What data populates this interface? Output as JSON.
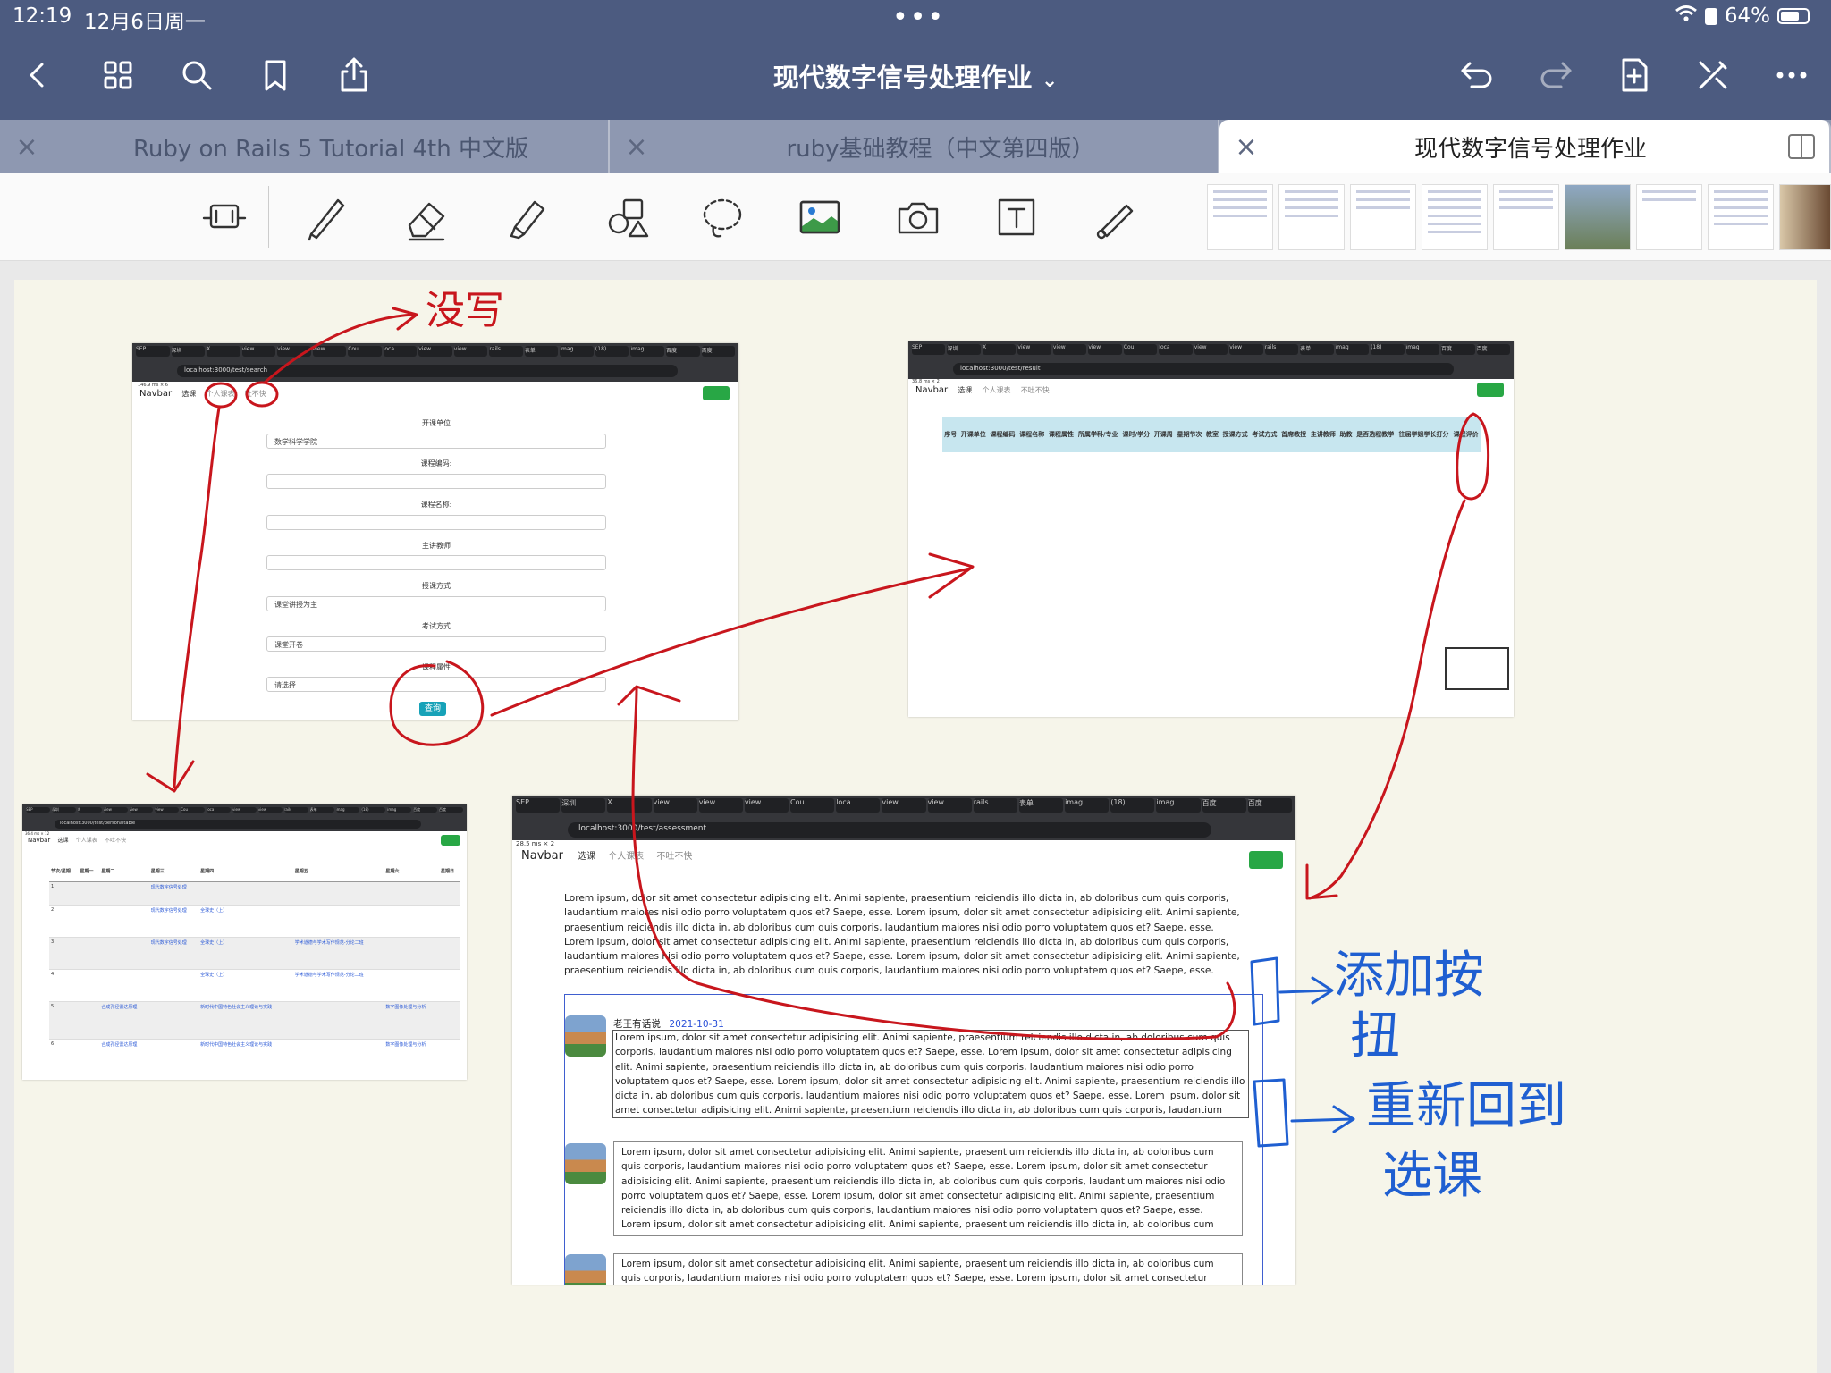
{
  "status": {
    "time": "12:19",
    "date": "12月6日周一",
    "battery": "64%"
  },
  "toolbar": {
    "title": "现代数字信号处理作业",
    "title_caret": "⌄"
  },
  "tabs": [
    {
      "label": "Ruby on Rails 5 Tutorial 4th 中文版"
    },
    {
      "label": "ruby基础教程（中文第四版）"
    },
    {
      "label": "现代数字信号处理作业"
    }
  ],
  "screens": {
    "search": {
      "url": "localhost:3000/test/search",
      "perf": "146.9 ms × 6",
      "nav": [
        "Navbar",
        "选课",
        "个人课表",
        "吐不快"
      ],
      "fields": [
        {
          "label": "开课单位",
          "value": "数学科学学院"
        },
        {
          "label": "课程编码:",
          "value": ""
        },
        {
          "label": "课程名称:",
          "value": ""
        },
        {
          "label": "主讲教师",
          "value": ""
        },
        {
          "label": "授课方式",
          "value": "课堂讲授为主"
        },
        {
          "label": "考试方式",
          "value": "课堂开卷"
        },
        {
          "label": "课程属性",
          "value": "请选择"
        }
      ],
      "button": "查询"
    },
    "result": {
      "url": "localhost:3000/test/result",
      "perf": "36.8 ms × 2",
      "nav": [
        "Navbar",
        "选课",
        "个人课表",
        "不吐不快"
      ],
      "headers": [
        "序号",
        "开课单位",
        "课程编码",
        "课程名称",
        "课程属性",
        "所属学科/专业",
        "课时/学分",
        "开课周",
        "星期节次",
        "教室",
        "授课方式",
        "考试方式",
        "首席教授",
        "主讲教师",
        "助教",
        "是否选程教学",
        "往届学姐学长打分",
        "课程评价"
      ]
    },
    "timetable": {
      "url": "localhost:3000/test/personaltable",
      "perf": "36.4 ms × 12",
      "nav": [
        "Navbar",
        "选课",
        "个人课表",
        "不吐不快"
      ],
      "headers": [
        "节次/星期",
        "星期一",
        "星期二",
        "星期三",
        "星期四",
        "星期五",
        "星期六",
        "星期日"
      ],
      "rows": [
        [
          "1",
          "",
          "",
          "现代数字信号处理",
          "",
          "",
          "",
          ""
        ],
        [
          "2",
          "",
          "",
          "现代数字信号处理",
          "全球史（上）",
          "",
          "",
          ""
        ],
        [
          "3",
          "",
          "",
          "现代数字信号处理",
          "全球史（上）",
          "学术道德与学术写作规范-分论二班",
          "",
          ""
        ],
        [
          "4",
          "",
          "",
          "",
          "全球史（上）",
          "学术道德与学术写作规范-分论二班",
          "",
          ""
        ],
        [
          "5",
          "",
          "合成孔径雷达原理",
          "",
          "新时代中国特色社会主义理论与实践",
          "",
          "数字图像处理与分析",
          ""
        ],
        [
          "6",
          "",
          "合成孔径雷达原理",
          "",
          "新时代中国特色社会主义理论与实践",
          "",
          "数字图像处理与分析",
          ""
        ]
      ]
    },
    "assessment": {
      "url": "localhost:3000/test/assessment",
      "perf": "28.5 ms × 2",
      "nav": [
        "Navbar",
        "选课",
        "个人课表",
        "不吐不快"
      ],
      "intro": "Lorem ipsum, dolor sit amet consectetur adipisicing elit. Animi sapiente, praesentium reiciendis illo dicta in, ab doloribus cum quis corporis, laudantium maiores nisi odio porro voluptatem quos et? Saepe, esse. Lorem ipsum, dolor sit amet consectetur adipisicing elit. Animi sapiente, praesentium reiciendis illo dicta in, ab doloribus cum quis corporis, laudantium maiores nisi odio porro voluptatem quos et? Saepe, esse. Lorem ipsum, dolor sit amet consectetur adipisicing elit. Animi sapiente, praesentium reiciendis illo dicta in, ab doloribus cum quis corporis, laudantium maiores nisi odio porro voluptatem quos et? Saepe, esse. Lorem ipsum, dolor sit amet consectetur adipisicing elit. Animi sapiente, praesentium reiciendis illo dicta in, ab doloribus cum quis corporis, laudantium maiores nisi odio porro voluptatem quos et? Saepe, esse. Lorem ipsum, dolor sit amet consectetur adipisicing elit. Animi sapiente, praesentium reiciendis illo dicta in, ab doloribus cum quis corporis, laudantium maiores nisi odio porro voluptatem quos et? Saepe, esse.",
      "post_author": "老王有话说",
      "post_date": "2021-10-31",
      "post_body": "Lorem ipsum, dolor sit amet consectetur adipisicing elit. Animi sapiente, praesentium reiciendis illo dicta in, ab doloribus cum quis corporis, laudantium maiores nisi odio porro voluptatem quos et? Saepe, esse. Lorem ipsum, dolor sit amet consectetur adipisicing elit. Animi sapiente, praesentium reiciendis illo dicta in, ab doloribus cum quis corporis, laudantium maiores nisi odio porro voluptatem quos et? Saepe, esse. Lorem ipsum, dolor sit amet consectetur adipisicing elit. Animi sapiente, praesentium reiciendis illo dicta in, ab doloribus cum quis corporis, laudantium maiores nisi odio porro voluptatem quos et? Saepe, esse. Lorem ipsum, dolor sit amet consectetur adipisicing elit. Animi sapiente, praesentium reiciendis illo dicta in, ab doloribus cum quis corporis, laudantium maiores nisi odio porro voluptatem quos et? Saepe, esse. Lorem ipsum, dolor sit",
      "comment_body": "Lorem ipsum, dolor sit amet consectetur adipisicing elit. Animi sapiente, praesentium reiciendis illo dicta in, ab doloribus cum quis corporis, laudantium maiores nisi odio porro voluptatem quos et? Saepe, esse. Lorem ipsum, dolor sit amet consectetur adipisicing elit. Animi sapiente, praesentium reiciendis illo dicta in, ab doloribus cum quis corporis, laudantium maiores nisi odio porro voluptatem quos et? Saepe, esse. Lorem ipsum, dolor sit amet consectetur adipisicing elit. Animi sapiente, praesentium reiciendis illo dicta in, ab doloribus cum quis corporis, laudantium maiores nisi odio porro voluptatem quos et? Saepe, esse. Lorem ipsum, dolor sit amet consectetur adipisicing elit. Animi sapiente, praesentium reiciendis illo dicta in, ab doloribus cum quis corporis, laudantium maiores nisi odio porro voluptatem quos et? Saepe, esse. Lorem ipsum, dolor",
      "comment_body_2": "Lorem ipsum, dolor sit amet consectetur adipisicing elit. Animi sapiente, praesentium reiciendis illo dicta in, ab doloribus cum quis corporis, laudantium maiores nisi odio porro voluptatem quos et? Saepe, esse. Lorem ipsum, dolor sit amet consectetur adipisicing elit. Animi sapiente, praesentium reiciendis illo dicta in, ab doloribus cum quis corporis,"
    }
  },
  "annotations": {
    "not_written": "没写",
    "add_button": "添加按钮",
    "back_to_course": "重新回到选课"
  },
  "colors": {
    "ink_red": "#c8161d",
    "ink_blue": "#1f5fd1",
    "toolbar": "#4c5b80"
  }
}
